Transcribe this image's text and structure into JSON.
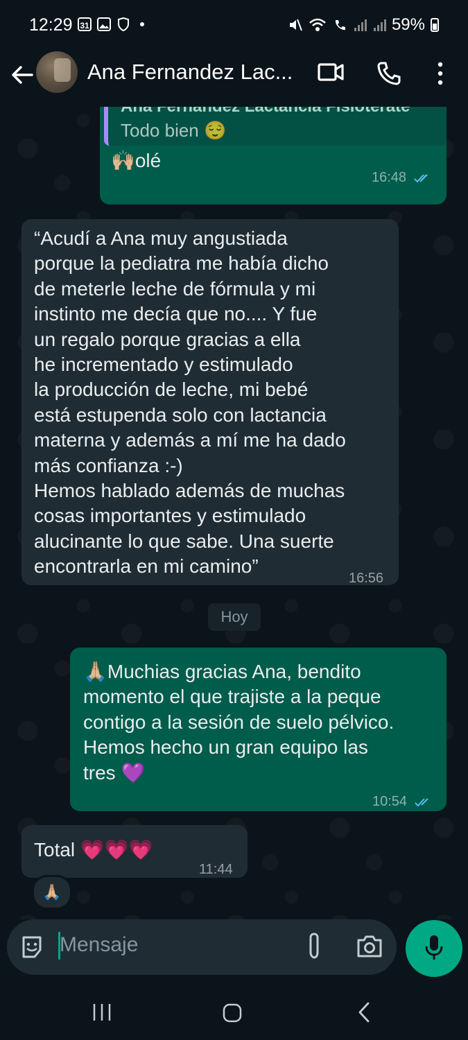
{
  "status_bar": {
    "time": "12:29",
    "calendar_badge": "31",
    "battery": "59%"
  },
  "header": {
    "contact_name": "Ana Fernandez Lac..."
  },
  "messages": [
    {
      "direction": "outgoing",
      "quoted_author": "Ana Fernandez Lactancia Fisioterate",
      "quoted_text": "Todo bien 😌",
      "text": "🙌🏼olé",
      "time": "16:48",
      "read": true
    },
    {
      "direction": "incoming",
      "lines": [
        "“Acudí a Ana muy angustiada",
        "porque la pediatra me había dicho",
        "de meterle leche de fórmula y mi",
        "instinto me decía que no.... Y fue",
        "un regalo porque gracias a ella",
        "he incrementado y estimulado",
        "la producción de leche, mi bebé",
        "está estupenda solo con lactancia",
        "materna y además a mí me ha dado",
        "más confianza :-)",
        "Hemos hablado además de muchas",
        "cosas importantes y estimulado",
        "alucinante lo que sabe. Una suerte",
        "encontrarla en mi camino”"
      ],
      "time": "16:56"
    },
    {
      "direction": "outgoing",
      "lines": [
        "🙏🏼Muchias gracias Ana, bendito",
        "momento el que trajiste a la peque",
        "contigo a la sesión de suelo pélvico.",
        "Hemos hecho un gran equipo las",
        "tres 💜"
      ],
      "time": "10:54",
      "read": true
    },
    {
      "direction": "incoming",
      "text": "Total 💗💗💗",
      "time": "11:44",
      "reaction": "🙏🏼"
    }
  ],
  "day_separator": "Hoy",
  "composer": {
    "placeholder": "Mensaje"
  },
  "colors": {
    "background": "#0b141a",
    "outgoing_bubble": "#005c4b",
    "incoming_bubble": "#202c33",
    "accent": "#00a884",
    "read_ticks": "#53bdeb"
  }
}
